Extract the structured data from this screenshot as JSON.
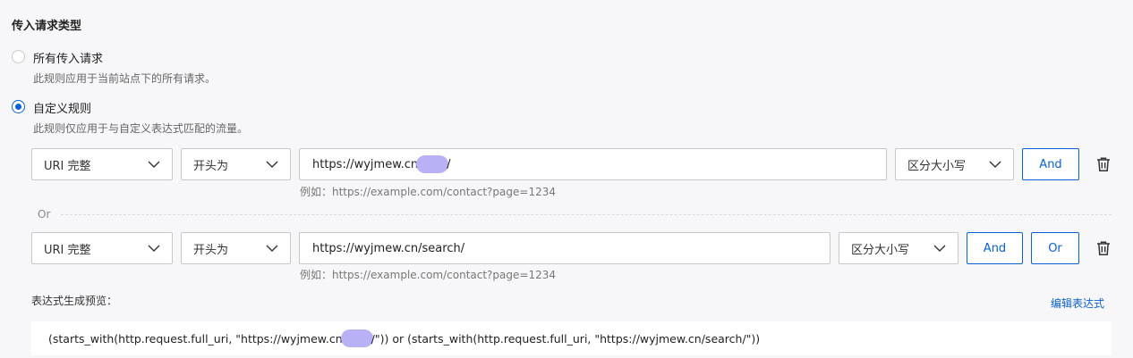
{
  "section_title": "传入请求类型",
  "options": [
    {
      "label": "所有传入请求",
      "description": "此规则应用于当前站点下的所有请求。",
      "checked": false
    },
    {
      "label": "自定义规则",
      "description": "此规则仅应用于与自定义表达式匹配的流量。",
      "checked": true
    }
  ],
  "rules": [
    {
      "field": "URI 完整",
      "operator": "开头为",
      "value_prefix": "https://wyjmew.cn",
      "value_suffix": "/",
      "hint": "例如：https://example.com/contact?page=1234",
      "case": "区分大小写",
      "and_label": "And"
    },
    {
      "field": "URI 完整",
      "operator": "开头为",
      "value": "https://wyjmew.cn/search/",
      "hint": "例如：https://example.com/contact?page=1234",
      "case": "区分大小写",
      "and_label": "And",
      "or_label": "Or"
    }
  ],
  "or_separator": "Or",
  "preview": {
    "label": "表达式生成预览：",
    "edit_label": "编辑表达式",
    "part1": "(starts_with(http.request.full_uri, \"https://wyjmew.cn",
    "part2": "/\")) or (starts_with(http.request.full_uri, \"https://wyjmew.cn/search/\"))"
  },
  "colors": {
    "accent": "#0a61d1",
    "redacted": "#b9b1f5"
  },
  "icons": {
    "dropdown": "chevron-down-icon",
    "delete": "trash-icon"
  }
}
